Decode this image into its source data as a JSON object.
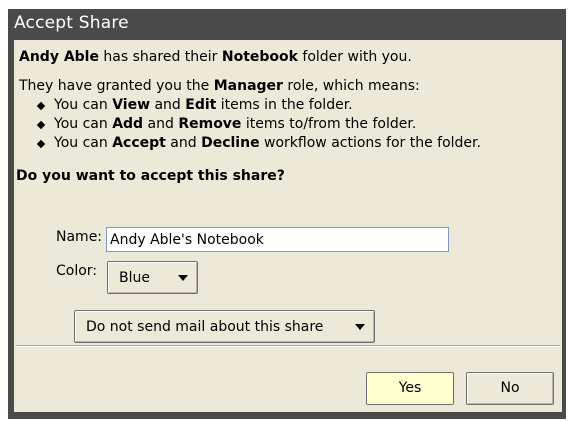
{
  "dialog": {
    "title": "Accept Share",
    "intro": {
      "owner": "Andy Able",
      "text1": " has shared their ",
      "folder": "Notebook",
      "text2": " folder with you."
    },
    "role_line": {
      "pre": "They have granted you the ",
      "role": "Manager",
      "post": " role, which means:"
    },
    "bullets": [
      {
        "pre": "You can ",
        "b1": "View",
        "mid": " and ",
        "b2": "Edit",
        "post": " items in the folder."
      },
      {
        "pre": "You can ",
        "b1": "Add",
        "mid": " and ",
        "b2": "Remove",
        "post": " items to/from the folder."
      },
      {
        "pre": "You can ",
        "b1": "Accept",
        "mid": " and ",
        "b2": "Decline",
        "post": " workflow actions for the folder."
      }
    ],
    "question": "Do you want to accept this share?",
    "name_label": "Name:",
    "name_value": "Andy Able's Notebook",
    "color_label": "Color:",
    "color_value": "Blue",
    "mail_option": "Do not send mail about this share",
    "yes_label": "Yes",
    "no_label": "No"
  },
  "colors": {
    "titlebar": "#4a4a4a",
    "dialog_bg": "#ece9d8",
    "yes_button_bg": "#ffffd0"
  }
}
